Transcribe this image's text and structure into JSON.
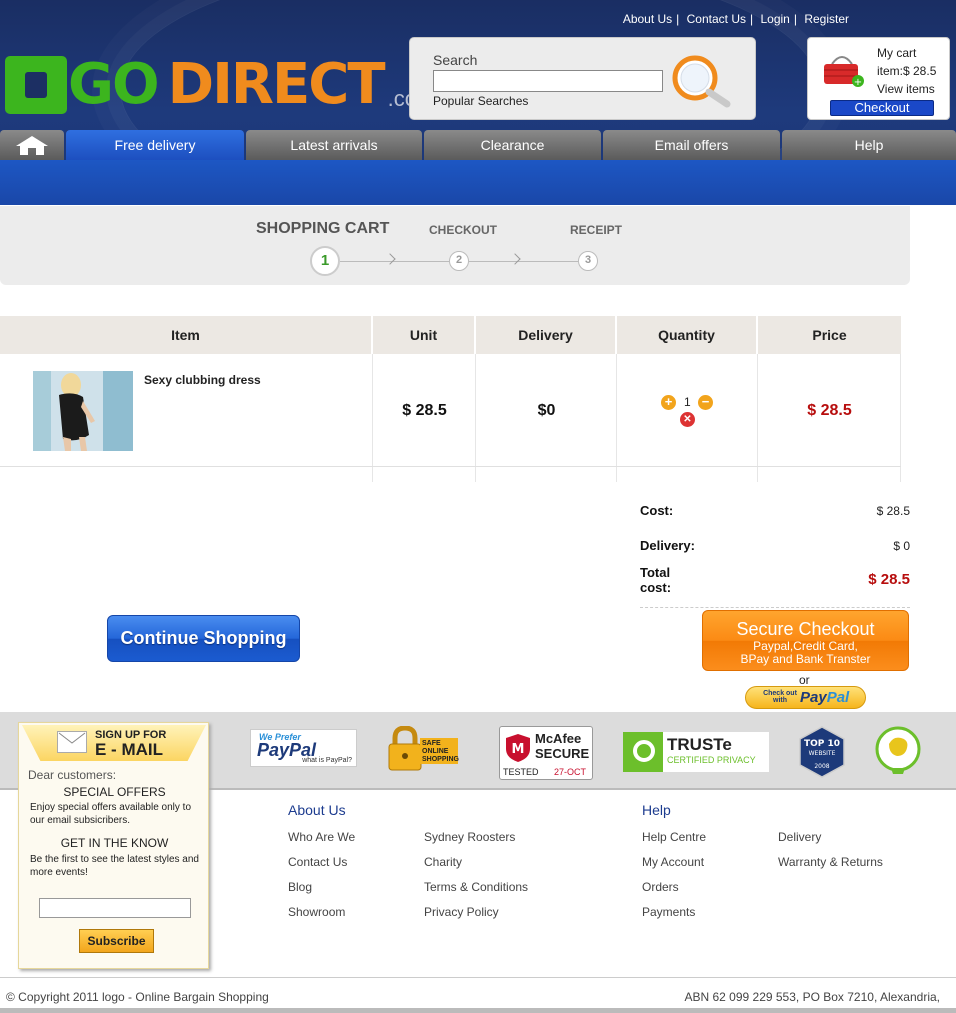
{
  "top_links": [
    "About Us",
    "Contact Us",
    "Login",
    "Register"
  ],
  "logo": {
    "go": "GO",
    "direct": "DIRECT",
    "suffix": ".com.au"
  },
  "search": {
    "label": "Search",
    "value": "",
    "popular": "Popular Searches"
  },
  "mini_cart": {
    "title": "My cart",
    "items_price": "item:$ 28.5",
    "view": "View items",
    "checkout": "Checkout"
  },
  "nav": {
    "home_icon": "home-icon",
    "tabs": [
      "Free delivery",
      "Latest arrivals",
      "Clearance",
      "Email offers",
      "Help"
    ],
    "active": "Free delivery"
  },
  "steps": {
    "step1": "SHOPPING CART",
    "step2": "CHECKOUT",
    "step3": "RECEIPT",
    "n1": "1",
    "n2": "2",
    "n3": "3"
  },
  "table": {
    "headers": [
      "Item",
      "Unit",
      "Delivery",
      "Quantity",
      "Price"
    ],
    "rows": [
      {
        "name": "Sexy clubbing dress",
        "unit": "$ 28.5",
        "delivery": "$0",
        "quantity": "1",
        "price": "$ 28.5"
      }
    ]
  },
  "totals": {
    "cost_label": "Cost:",
    "cost": "$ 28.5",
    "delivery_label": "Delivery:",
    "delivery": "$ 0",
    "total_label_1": "Total",
    "total_label_2": "cost:",
    "total": "$ 28.5"
  },
  "buttons": {
    "continue": "Continue Shopping",
    "secure_title": "Secure Checkout",
    "secure_line1": "Paypal,Credit Card,",
    "secure_line2": "BPay and Bank Transter",
    "or": "or",
    "paypal_small": "Check out with",
    "paypal_pay": "Pay",
    "paypal_pal": "Pal"
  },
  "trust": {
    "paypal_top": "We Prefer",
    "paypal_logo": "PayPal",
    "paypal_sub": "what is PayPal?",
    "safe": "SAFE ONLINE SHOPPING",
    "mcafee": "McAfee",
    "mcafee_secure": "SECURE",
    "mcafee_tested": "TESTED",
    "mcafee_date": "27-OCT",
    "truste": "TRUSTe",
    "truste_sub": "CERTIFIED PRIVACY",
    "top10": "TOP 10",
    "top10_sub": "WEBSITE",
    "top10_year": "2008"
  },
  "signup": {
    "sign_up_for": "SIGN UP FOR",
    "email": "E - MAIL",
    "dear": "Dear customers:",
    "special": "SPECIAL OFFERS",
    "special_text": "Enjoy special offers available only to our email subsicribers.",
    "know": "GET IN THE KNOW",
    "know_text": "Be the first to see the latest styles and more events!",
    "subscribe": "Subscribe"
  },
  "footer": {
    "about_title": "About Us",
    "about_col1": [
      "Who Are We",
      "Contact Us",
      "Blog",
      "Showroom"
    ],
    "about_col2": [
      "Sydney Roosters",
      "Charity",
      "Terms & Conditions",
      "Privacy Policy"
    ],
    "help_title": "Help",
    "help_col1": [
      "Help Centre",
      "My Account",
      "Orders",
      "Payments"
    ],
    "help_col2": [
      "Delivery",
      "Warranty & Returns"
    ],
    "copyright": "© Copyright 2011 logo - Online Bargain Shopping",
    "abn": "ABN 62 099 229 553, PO Box 7210, Alexandria,"
  },
  "colors": {
    "header": "#1e3a7c",
    "nav_active": "#2f6fe0",
    "price_red": "#b70d0d",
    "orange": "#f08b1d",
    "green": "#3cb51e"
  }
}
